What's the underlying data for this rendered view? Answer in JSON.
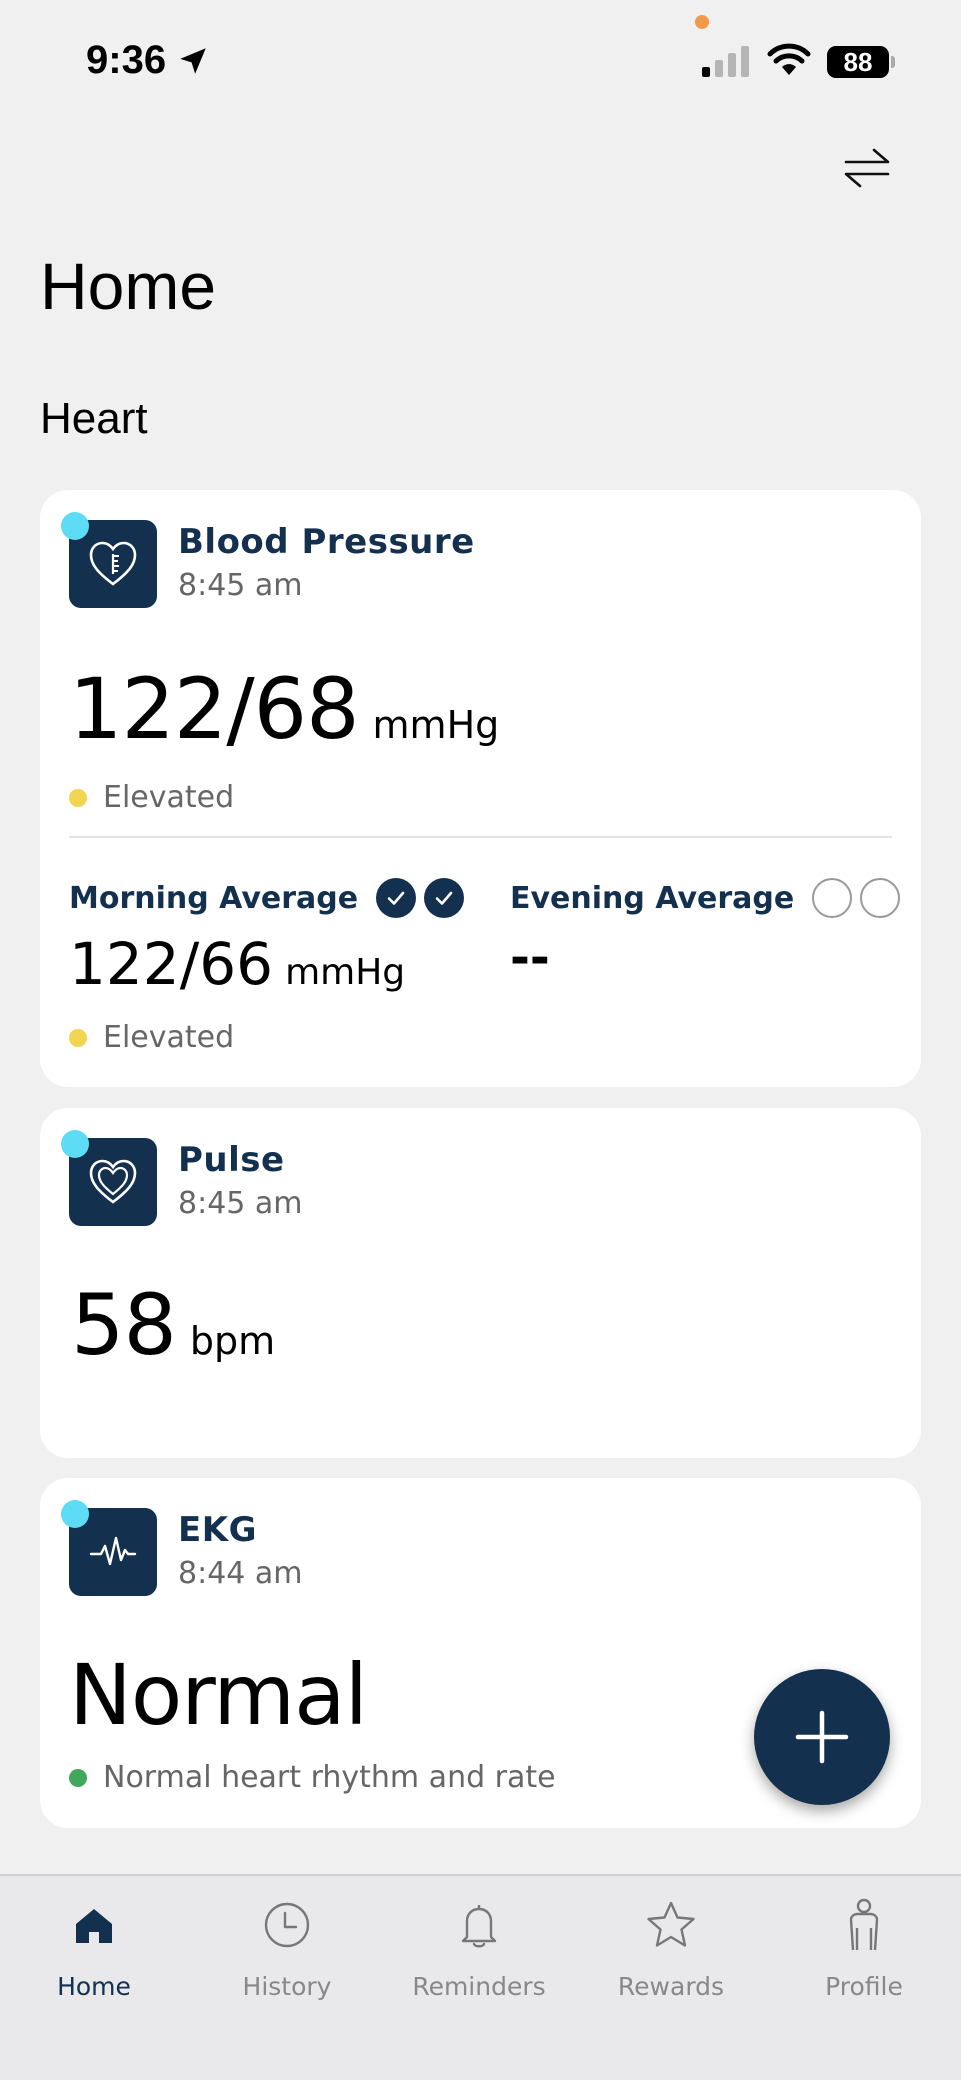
{
  "colors": {
    "navy": "#14304f",
    "new_dot": "#5fdcf5",
    "status_elevated": "#f2d552",
    "status_normal": "#3fa85a",
    "tab_inactive": "#888888",
    "divider": "#e3e3e3",
    "camera_dot": "#f2994a"
  },
  "status_bar": {
    "time": "9:36",
    "battery": "88"
  },
  "header": {
    "page_title": "Home",
    "section_title": "Heart",
    "swap_icon": "swap-arrows-icon"
  },
  "blood_pressure": {
    "title": "Blood Pressure",
    "time": "8:45 am",
    "value": "122/68",
    "unit": "mmHg",
    "status": "Elevated",
    "morning": {
      "label": "Morning Average",
      "value": "122/66",
      "unit": "mmHg",
      "status": "Elevated",
      "checks_done": 2,
      "checks_total": 2
    },
    "evening": {
      "label": "Evening Average",
      "value": "--",
      "checks_done": 0,
      "checks_total": 2
    }
  },
  "pulse": {
    "title": "Pulse",
    "time": "8:45 am",
    "value": "58",
    "unit": "bpm"
  },
  "ekg": {
    "title": "EKG",
    "time": "8:44 am",
    "value": "Normal",
    "status": "Normal heart rhythm and rate"
  },
  "fab": {
    "icon": "plus-icon"
  },
  "tabs": [
    {
      "label": "Home",
      "icon": "home-icon",
      "active": true
    },
    {
      "label": "History",
      "icon": "clock-icon",
      "active": false
    },
    {
      "label": "Reminders",
      "icon": "bell-icon",
      "active": false
    },
    {
      "label": "Rewards",
      "icon": "star-icon",
      "active": false
    },
    {
      "label": "Profile",
      "icon": "person-icon",
      "active": false
    }
  ]
}
